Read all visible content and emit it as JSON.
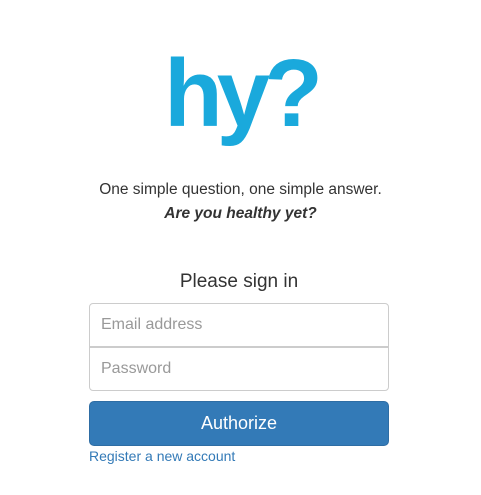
{
  "logo": {
    "text": "hy?",
    "color": "#1aa9dc"
  },
  "intro": {
    "tagline": "One simple question, one simple answer.",
    "question": "Are you healthy yet?"
  },
  "signin": {
    "heading": "Please sign in",
    "email_placeholder": "Email address",
    "email_value": "",
    "password_placeholder": "Password",
    "password_value": "",
    "submit_label": "Authorize",
    "register_link": "Register a new account"
  },
  "colors": {
    "brand": "#1aa9dc",
    "button": "#337ab7",
    "link": "#337ab7",
    "text": "#333333"
  }
}
